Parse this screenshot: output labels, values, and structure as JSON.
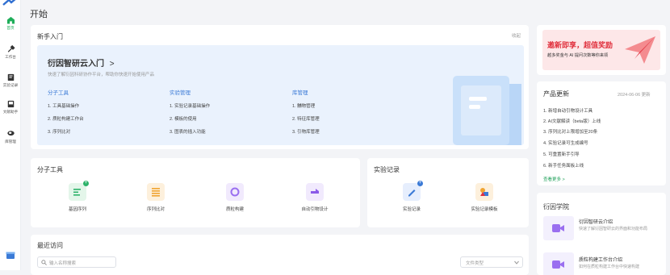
{
  "sidebar": {
    "items": [
      {
        "label": "首页",
        "icon": "home-icon"
      },
      {
        "label": "工作台",
        "icon": "tools-icon"
      },
      {
        "label": "实验记录",
        "icon": "notebook-icon"
      },
      {
        "label": "文献助手",
        "icon": "book-icon"
      },
      {
        "label": "库管理",
        "icon": "database-icon"
      }
    ]
  },
  "page_title": "开始",
  "getting_started": {
    "title": "新手入门",
    "collapse": "收起",
    "product": "衍因智研云入门",
    "product_arrow": ">",
    "subtitle": "快速了解衍因科研协作平台，帮助你快速开始使用产品",
    "columns": [
      {
        "title": "分子工具",
        "items": [
          "1. 工具基础操作",
          "2. 质粒构建工作台",
          "3. 序列比对"
        ]
      },
      {
        "title": "实验管理",
        "items": [
          "1. 实验记录基础操作",
          "2. 模板的使用",
          "3. 图表的插入功能"
        ]
      },
      {
        "title": "库管理",
        "items": [
          "1. 黼物管理",
          "2. 特征库管理",
          "3. 引物库管理"
        ]
      }
    ]
  },
  "molecular_tools": {
    "title": "分子工具",
    "items": [
      {
        "label": "基因序列",
        "icon": "sequence-icon"
      },
      {
        "label": "序列比对",
        "icon": "alignment-icon"
      },
      {
        "label": "质粒构建",
        "icon": "plasmid-icon"
      },
      {
        "label": "自动引物设计",
        "icon": "primer-icon"
      }
    ]
  },
  "experiment_records": {
    "title": "实验记录",
    "items": [
      {
        "label": "实验记录",
        "icon": "record-icon"
      },
      {
        "label": "实验记录模板",
        "icon": "template-icon"
      }
    ]
  },
  "recent": {
    "title": "最近访问",
    "search_placeholder": "输入名称搜索",
    "file_type": "文件类型"
  },
  "banner": {
    "title": "邀新即享，超值奖励",
    "subtitle": "越多奖金与 AI 提问次数等你来领"
  },
  "updates": {
    "title": "产品更新",
    "date": "2024-06-06 更新",
    "items": [
      "1. 新增自动引物设计工具",
      "2. AI文献解读（beta版）上线",
      "3. 序列比对上限增加至20条",
      "4. 实验记录可生成编号",
      "5. 可重置新手引导",
      "6. 新手任务面板上线"
    ],
    "more": "查看更多 >"
  },
  "academy": {
    "title": "衍因学院",
    "items": [
      {
        "title": "衍因智研云介绍",
        "desc": "快速了解衍因智研云的界面和功能布局"
      },
      {
        "title": "质粒构建工作台介绍",
        "desc": "如何在质粒构建工作台中快速构建"
      }
    ]
  },
  "colors": {
    "accent": "#3b7ad6",
    "green": "#20a15a",
    "banner_red": "#e0313e"
  }
}
